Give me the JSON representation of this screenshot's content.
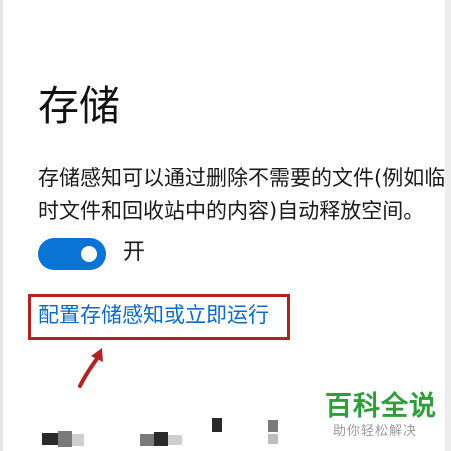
{
  "header": {
    "title": "存储"
  },
  "storage_sense": {
    "description": "存储感知可以通过删除不需要的文件(例如临时文件和回收站中的内容)自动释放空间。",
    "toggle": {
      "state": "on",
      "label": "开"
    },
    "config_link": "配置存储感知或立即运行"
  },
  "annotation": {
    "highlight_color": "#b02323",
    "arrow_color": "#b02323"
  },
  "watermark": {
    "brand": "百科全说",
    "tagline": "助你轻松解决",
    "brand_color": "#2f9e3a"
  },
  "colors": {
    "accent": "#0a74d4",
    "link": "#0b6bc7"
  }
}
